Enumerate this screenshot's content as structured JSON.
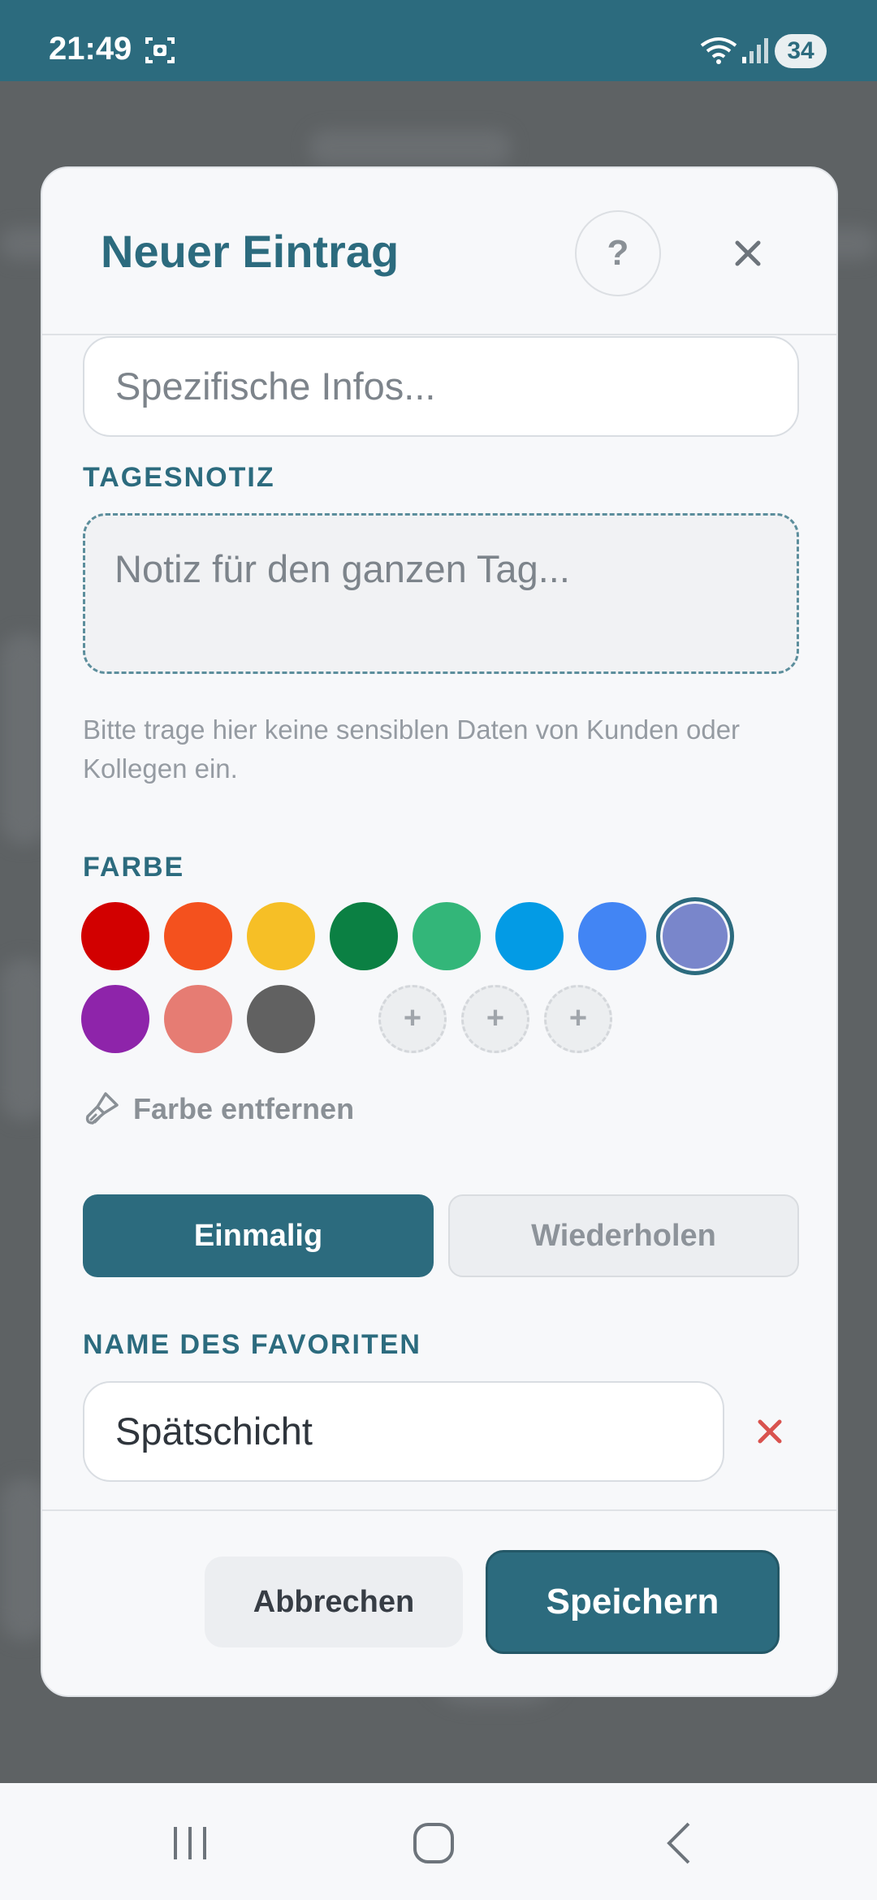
{
  "status_bar": {
    "time": "21:49",
    "battery": "34",
    "icons": [
      "screenshot-icon",
      "wifi-icon",
      "signal-icon"
    ]
  },
  "dialog": {
    "title": "Neuer Eintrag",
    "help_label": "?",
    "specific_info": {
      "placeholder": "Spezifische Infos..."
    },
    "day_note": {
      "label": "TAGESNOTIZ",
      "placeholder": "Notiz für den ganzen Tag..."
    },
    "hint": "Bitte trage hier keine sensiblen Daten von Kunden oder Kollegen ein.",
    "color": {
      "label": "FARBE",
      "swatches": [
        "#d20000",
        "#f4511e",
        "#f6bf26",
        "#0b8043",
        "#33b679",
        "#039be5",
        "#4285f4",
        "#7986cb",
        "#8e24aa",
        "#e67c73",
        "#616161"
      ],
      "selected": "#7986cb",
      "add_label": "+",
      "remove_label": "Farbe entfernen"
    },
    "recurrence": {
      "options": [
        "Einmalig",
        "Wiederholen"
      ],
      "active": "Einmalig"
    },
    "favorite": {
      "label": "NAME DES FAVORITEN",
      "value": "Spätschicht"
    },
    "footer": {
      "cancel": "Abbrechen",
      "save": "Speichern"
    }
  },
  "colors": {
    "accent": "#2c6b7e",
    "status_bar": "#2c6b7e",
    "danger": "#d9534f"
  },
  "nav_bar": {
    "icons": [
      "recent-apps-icon",
      "home-icon",
      "back-icon"
    ]
  }
}
